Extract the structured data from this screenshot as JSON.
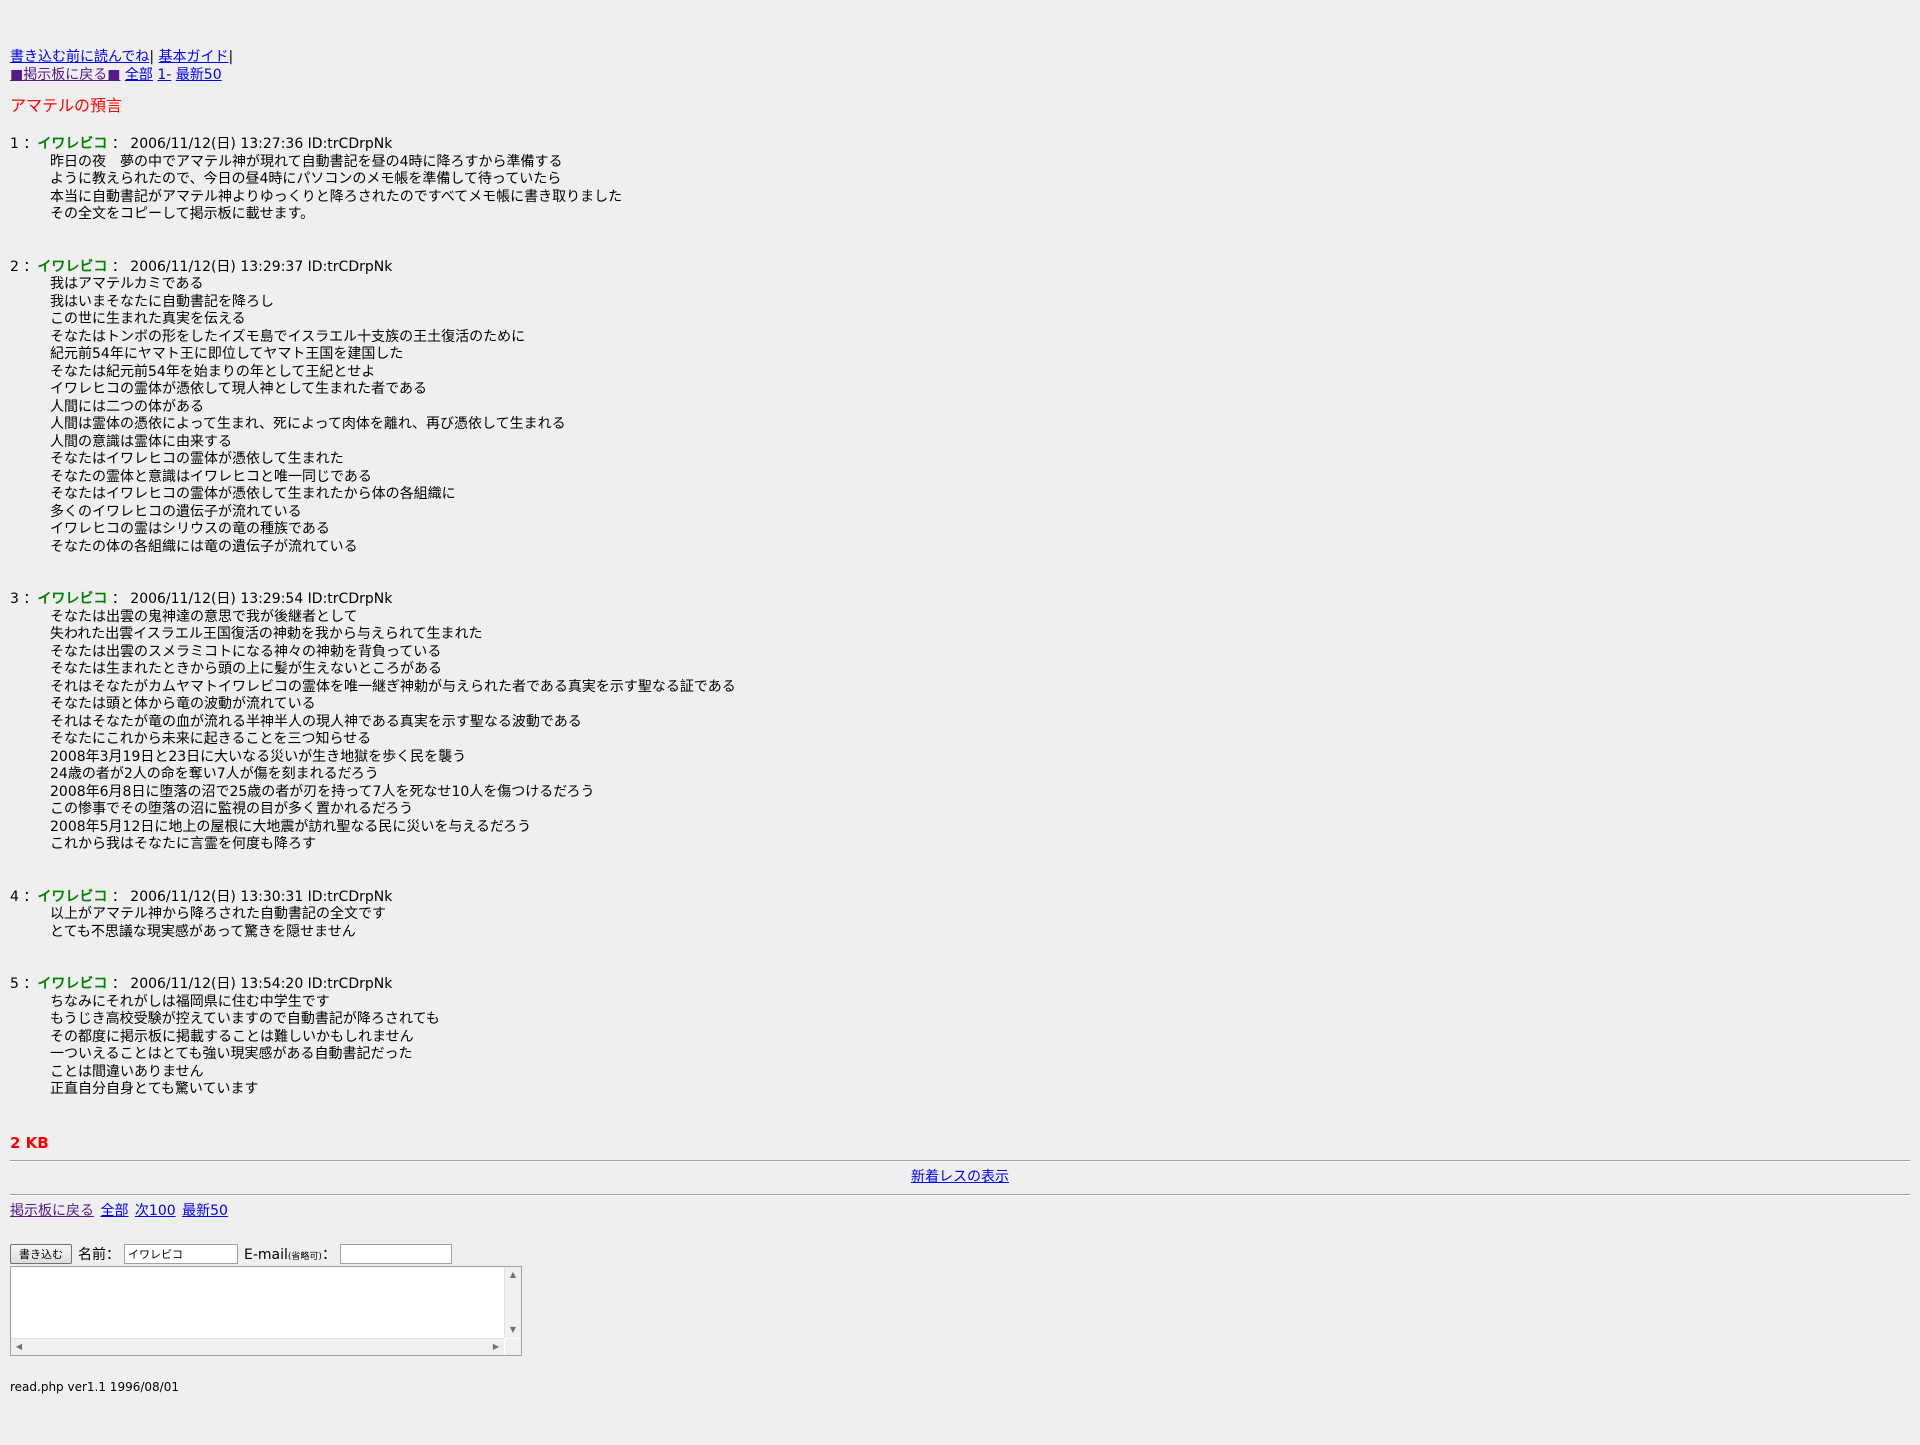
{
  "topnav": {
    "read_first": "書き込む前に読んでね",
    "basic_guide": "基本ガイド",
    "back_to_board": "■掲示板に戻る■",
    "all": "全部",
    "one": "1-",
    "latest50": "最新50"
  },
  "thread_title": "アマテルの預言",
  "posts": [
    {
      "number": "1",
      "name": "イワレビコ",
      "meta": "2006/11/12(日) 13:27:36 ID:trCDrpNk",
      "lines": [
        "昨日の夜　夢の中でアマテル神が現れて自動書記を昼の4時に降ろすから準備する",
        "ように教えられたので、今日の昼4時にパソコンのメモ帳を準備して待っていたら",
        "本当に自動書記がアマテル神よりゆっくりと降ろされたのですべてメモ帳に書き取りました",
        "その全文をコピーして掲示板に載せます。"
      ]
    },
    {
      "number": "2",
      "name": "イワレビコ",
      "meta": "2006/11/12(日) 13:29:37 ID:trCDrpNk",
      "lines": [
        "我はアマテルカミである",
        "我はいまそなたに自動書記を降ろし",
        "この世に生まれた真実を伝える",
        "そなたはトンボの形をしたイズモ島でイスラエル十支族の王土復活のために",
        "紀元前54年にヤマト王に即位してヤマト王国を建国した",
        "そなたは紀元前54年を始まりの年として王紀とせよ",
        "イワレヒコの霊体が憑依して現人神として生まれた者である",
        "人間には二つの体がある",
        "人間は霊体の憑依によって生まれ、死によって肉体を離れ、再び憑依して生まれる",
        "人間の意識は霊体に由来する",
        "そなたはイワレヒコの霊体が憑依して生まれた",
        "そなたの霊体と意識はイワレヒコと唯一同じである",
        "そなたはイワレヒコの霊体が憑依して生まれたから体の各組織に",
        "多くのイワレヒコの遺伝子が流れている",
        "イワレヒコの霊はシリウスの竜の種族である",
        "そなたの体の各組織には竜の遺伝子が流れている"
      ]
    },
    {
      "number": "3",
      "name": "イワレビコ",
      "meta": "2006/11/12(日) 13:29:54 ID:trCDrpNk",
      "lines": [
        "そなたは出雲の鬼神達の意思で我が後継者として",
        "失われた出雲イスラエル王国復活の神勅を我から与えられて生まれた",
        "そなたは出雲のスメラミコトになる神々の神勅を背負っている",
        "そなたは生まれたときから頭の上に髪が生えないところがある",
        "それはそなたがカムヤマトイワレビコの霊体を唯一継ぎ神勅が与えられた者である真実を示す聖なる証である",
        "そなたは頭と体から竜の波動が流れている",
        "それはそなたが竜の血が流れる半神半人の現人神である真実を示す聖なる波動である",
        "そなたにこれから未来に起きることを三つ知らせる",
        "2008年3月19日と23日に大いなる災いが生き地獄を歩く民を襲う",
        "24歳の者が2人の命を奪い7人が傷を刻まれるだろう",
        "2008年6月8日に堕落の沼で25歳の者が刃を持って7人を死なせ10人を傷つけるだろう",
        "この惨事でその堕落の沼に監視の目が多く置かれるだろう",
        "2008年5月12日に地上の屋根に大地震が訪れ聖なる民に災いを与えるだろう",
        "これから我はそなたに言霊を何度も降ろす"
      ]
    },
    {
      "number": "4",
      "name": "イワレビコ",
      "meta": "2006/11/12(日) 13:30:31 ID:trCDrpNk",
      "lines": [
        "以上がアマテル神から降ろされた自動書記の全文です",
        "とても不思議な現実感があって驚きを隠せません"
      ]
    },
    {
      "number": "5",
      "name": "イワレビコ",
      "meta": "2006/11/12(日) 13:54:20 ID:trCDrpNk",
      "lines": [
        "ちなみにそれがしは福岡県に住む中学生です",
        "もうじき高校受験が控えていますので自動書記が降ろされても",
        "その都度に掲示板に掲載することは難しいかもしれません",
        "一ついえることはとても強い現実感がある自動書記だった",
        "ことは間違いありません",
        "正直自分自身とても驚いています"
      ]
    }
  ],
  "size_text": "2 KB",
  "new_posts_link": "新着レスの表示",
  "bottomnav": {
    "back_to_board": "掲示板に戻る",
    "all": "全部",
    "next100": "次100",
    "latest50": "最新50"
  },
  "form": {
    "submit_label": "書き込む",
    "name_label": "名前：",
    "name_value": "イワレビコ",
    "email_label": "E-mail",
    "email_note": "(省略可)",
    "email_suffix": "：",
    "email_value": "",
    "message_value": ""
  },
  "footer": "read.php ver1.1 1996/08/01",
  "colors": {
    "background": "#efefef",
    "link": "#0000ee",
    "visited_link": "#551a8b",
    "title": "#ff0000",
    "name": "#008000"
  }
}
